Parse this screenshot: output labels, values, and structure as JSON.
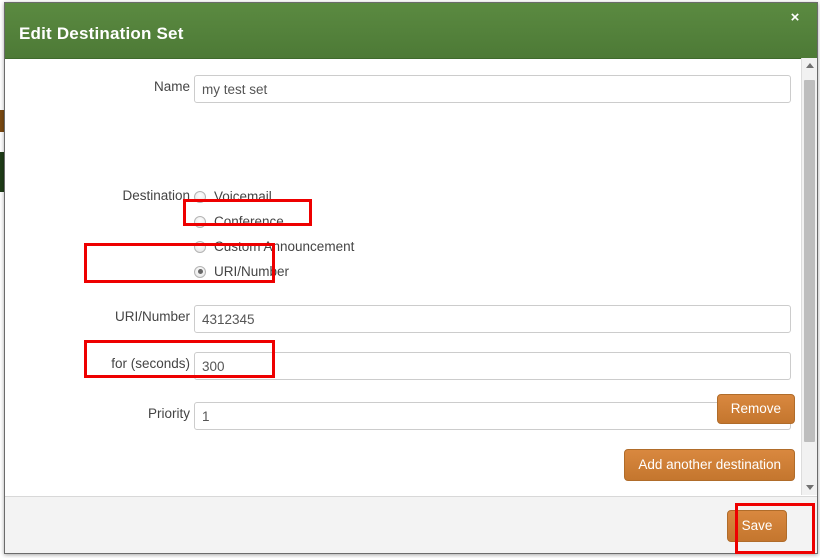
{
  "dialog": {
    "title": "Edit Destination Set",
    "close_label": "×"
  },
  "form": {
    "name": {
      "label": "Name",
      "value": "my test set",
      "placeholder": ""
    },
    "destination": {
      "label": "Destination",
      "options": [
        {
          "label": "Voicemail",
          "selected": false
        },
        {
          "label": "Conference",
          "selected": false
        },
        {
          "label": "Custom Announcement",
          "selected": false
        },
        {
          "label": "URI/Number",
          "selected": true
        }
      ]
    },
    "uri_number": {
      "label": "URI/Number",
      "value": "4312345",
      "placeholder": ""
    },
    "for_seconds": {
      "label": "for (seconds)",
      "value": "300",
      "placeholder": ""
    },
    "priority": {
      "label": "Priority",
      "value": "1",
      "placeholder": ""
    }
  },
  "buttons": {
    "remove": "Remove",
    "add_destination": "Add another destination",
    "save": "Save"
  },
  "colors": {
    "header_green": "#4d7a36",
    "button_orange": "#c4762e",
    "annotation_red": "#ee0000"
  }
}
